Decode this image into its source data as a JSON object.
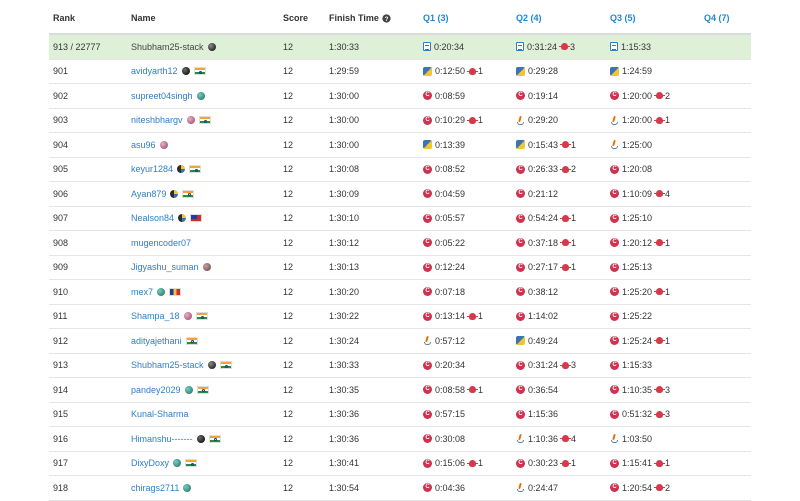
{
  "header": {
    "rank": "Rank",
    "name": "Name",
    "score": "Score",
    "finish_time": "Finish Time",
    "q1": "Q1 (3)",
    "q2": "Q2 (4)",
    "q3": "Q3 (5)",
    "q4": "Q4 (7)",
    "help_icon": "question-circle-icon"
  },
  "colors": {
    "highlight_row": "#dff0d8",
    "link": "#2e7ec7",
    "question_header": "#1e88d6",
    "bug": "#d53a4a"
  },
  "rows": [
    {
      "rank": "913 / 22777",
      "name": "Shubham25-stack",
      "badge": "knight",
      "flag": "",
      "score": "12",
      "finish": "1:30:33",
      "highlight": true,
      "q1": {
        "lang": "file",
        "time": "0:20:34",
        "fails": ""
      },
      "q2": {
        "lang": "file",
        "time": "0:31:24",
        "fails": "3"
      },
      "q3": {
        "lang": "file",
        "time": "1:15:33",
        "fails": ""
      }
    },
    {
      "rank": "901",
      "name": "avidyarth12",
      "badge": "guardian",
      "flag": "in",
      "score": "12",
      "finish": "1:29:59",
      "q1": {
        "lang": "python",
        "time": "0:12:50",
        "fails": "1"
      },
      "q2": {
        "lang": "python",
        "time": "0:29:28",
        "fails": ""
      },
      "q3": {
        "lang": "python",
        "time": "1:24:59",
        "fails": ""
      }
    },
    {
      "rank": "902",
      "name": "supreet04singh",
      "badge": "teal",
      "flag": "",
      "score": "12",
      "finish": "1:30:00",
      "q1": {
        "lang": "cpp",
        "time": "0:08:59",
        "fails": ""
      },
      "q2": {
        "lang": "cpp",
        "time": "0:19:14",
        "fails": ""
      },
      "q3": {
        "lang": "cpp",
        "time": "1:20:00",
        "fails": "2"
      }
    },
    {
      "rank": "903",
      "name": "niteshbhargv",
      "badge": "pink",
      "flag": "in",
      "score": "12",
      "finish": "1:30:00",
      "q1": {
        "lang": "cpp",
        "time": "0:10:29",
        "fails": "1"
      },
      "q2": {
        "lang": "java",
        "time": "0:29:20",
        "fails": ""
      },
      "q3": {
        "lang": "java",
        "time": "1:20:00",
        "fails": "1"
      }
    },
    {
      "rank": "904",
      "name": "asu96",
      "badge": "pink",
      "flag": "",
      "score": "12",
      "finish": "1:30:00",
      "q1": {
        "lang": "python",
        "time": "0:13:39",
        "fails": ""
      },
      "q2": {
        "lang": "python",
        "time": "0:15:43",
        "fails": "1"
      },
      "q3": {
        "lang": "java",
        "time": "1:25:00",
        "fails": ""
      }
    },
    {
      "rank": "905",
      "name": "keyur1284",
      "badge": "mixed",
      "flag": "in",
      "score": "12",
      "finish": "1:30:08",
      "q1": {
        "lang": "cpp",
        "time": "0:08:52",
        "fails": ""
      },
      "q2": {
        "lang": "cpp",
        "time": "0:26:33",
        "fails": "2"
      },
      "q3": {
        "lang": "cpp",
        "time": "1:20:08",
        "fails": ""
      }
    },
    {
      "rank": "906",
      "name": "Ayan879",
      "badge": "mixed",
      "flag": "in",
      "score": "12",
      "finish": "1:30:09",
      "q1": {
        "lang": "cpp",
        "time": "0:04:59",
        "fails": ""
      },
      "q2": {
        "lang": "cpp",
        "time": "0:21:12",
        "fails": ""
      },
      "q3": {
        "lang": "cpp",
        "time": "1:10:09",
        "fails": "4"
      }
    },
    {
      "rank": "907",
      "name": "Nealson84",
      "badge": "mixed",
      "flag": "tw",
      "score": "12",
      "finish": "1:30:10",
      "q1": {
        "lang": "cpp",
        "time": "0:05:57",
        "fails": ""
      },
      "q2": {
        "lang": "cpp",
        "time": "0:54:24",
        "fails": "1"
      },
      "q3": {
        "lang": "cpp",
        "time": "1:25:10",
        "fails": ""
      }
    },
    {
      "rank": "908",
      "name": "mugencoder07",
      "badge": "",
      "flag": "",
      "score": "12",
      "finish": "1:30:12",
      "q1": {
        "lang": "cpp",
        "time": "0:05:22",
        "fails": ""
      },
      "q2": {
        "lang": "cpp",
        "time": "0:37:18",
        "fails": "1"
      },
      "q3": {
        "lang": "cpp",
        "time": "1:20:12",
        "fails": "1"
      }
    },
    {
      "rank": "909",
      "name": "Jigyashu_suman",
      "badge": "grey",
      "flag": "",
      "score": "12",
      "finish": "1:30:13",
      "q1": {
        "lang": "cpp",
        "time": "0:12:24",
        "fails": ""
      },
      "q2": {
        "lang": "cpp",
        "time": "0:27:17",
        "fails": "1"
      },
      "q3": {
        "lang": "cpp",
        "time": "1:25:13",
        "fails": ""
      }
    },
    {
      "rank": "910",
      "name": "mex7",
      "badge": "teal",
      "flag": "ro",
      "score": "12",
      "finish": "1:30:20",
      "q1": {
        "lang": "cpp",
        "time": "0:07:18",
        "fails": ""
      },
      "q2": {
        "lang": "cpp",
        "time": "0:38:12",
        "fails": ""
      },
      "q3": {
        "lang": "cpp",
        "time": "1:25:20",
        "fails": "1"
      }
    },
    {
      "rank": "911",
      "name": "Shampa_18",
      "badge": "pink",
      "flag": "in",
      "score": "12",
      "finish": "1:30:22",
      "q1": {
        "lang": "cpp",
        "time": "0:13:14",
        "fails": "1"
      },
      "q2": {
        "lang": "cpp",
        "time": "1:14:02",
        "fails": ""
      },
      "q3": {
        "lang": "cpp",
        "time": "1:25:22",
        "fails": ""
      }
    },
    {
      "rank": "912",
      "name": "adityajethani",
      "badge": "",
      "flag": "in",
      "score": "12",
      "finish": "1:30:24",
      "q1": {
        "lang": "java",
        "time": "0:57:12",
        "fails": ""
      },
      "q2": {
        "lang": "python",
        "time": "0:49:24",
        "fails": ""
      },
      "q3": {
        "lang": "cpp",
        "time": "1:25:24",
        "fails": "1"
      }
    },
    {
      "rank": "913",
      "name": "Shubham25-stack",
      "badge": "knight",
      "flag": "in",
      "score": "12",
      "finish": "1:30:33",
      "q1": {
        "lang": "cpp",
        "time": "0:20:34",
        "fails": ""
      },
      "q2": {
        "lang": "cpp",
        "time": "0:31:24",
        "fails": "3"
      },
      "q3": {
        "lang": "cpp",
        "time": "1:15:33",
        "fails": ""
      }
    },
    {
      "rank": "914",
      "name": "pandey2029",
      "badge": "teal",
      "flag": "in",
      "score": "12",
      "finish": "1:30:35",
      "q1": {
        "lang": "cpp",
        "time": "0:08:58",
        "fails": "1"
      },
      "q2": {
        "lang": "cpp",
        "time": "0:36:54",
        "fails": ""
      },
      "q3": {
        "lang": "cpp",
        "time": "1:10:35",
        "fails": "3"
      }
    },
    {
      "rank": "915",
      "name": "Kunal-Sharma",
      "badge": "",
      "flag": "",
      "score": "12",
      "finish": "1:30:36",
      "q1": {
        "lang": "cpp",
        "time": "0:57:15",
        "fails": ""
      },
      "q2": {
        "lang": "cpp",
        "time": "1:15:36",
        "fails": ""
      },
      "q3": {
        "lang": "cpp",
        "time": "0:51:32",
        "fails": "3"
      }
    },
    {
      "rank": "916",
      "name": "Himanshu-------",
      "badge": "guardian",
      "flag": "in",
      "score": "12",
      "finish": "1:30:36",
      "q1": {
        "lang": "cpp",
        "time": "0:30:08",
        "fails": ""
      },
      "q2": {
        "lang": "java",
        "time": "1:10:36",
        "fails": "4"
      },
      "q3": {
        "lang": "java",
        "time": "1:03:50",
        "fails": ""
      }
    },
    {
      "rank": "917",
      "name": "DixyDoxy",
      "badge": "teal",
      "flag": "in",
      "score": "12",
      "finish": "1:30:41",
      "q1": {
        "lang": "cpp",
        "time": "0:15:06",
        "fails": "1"
      },
      "q2": {
        "lang": "cpp",
        "time": "0:30:23",
        "fails": "1"
      },
      "q3": {
        "lang": "cpp",
        "time": "1:15:41",
        "fails": "1"
      }
    },
    {
      "rank": "918",
      "name": "chirags2711",
      "badge": "teal",
      "flag": "",
      "score": "12",
      "finish": "1:30:54",
      "q1": {
        "lang": "cpp",
        "time": "0:04:36",
        "fails": ""
      },
      "q2": {
        "lang": "java",
        "time": "0:24:47",
        "fails": ""
      },
      "q3": {
        "lang": "cpp",
        "time": "1:20:54",
        "fails": "2"
      }
    }
  ]
}
